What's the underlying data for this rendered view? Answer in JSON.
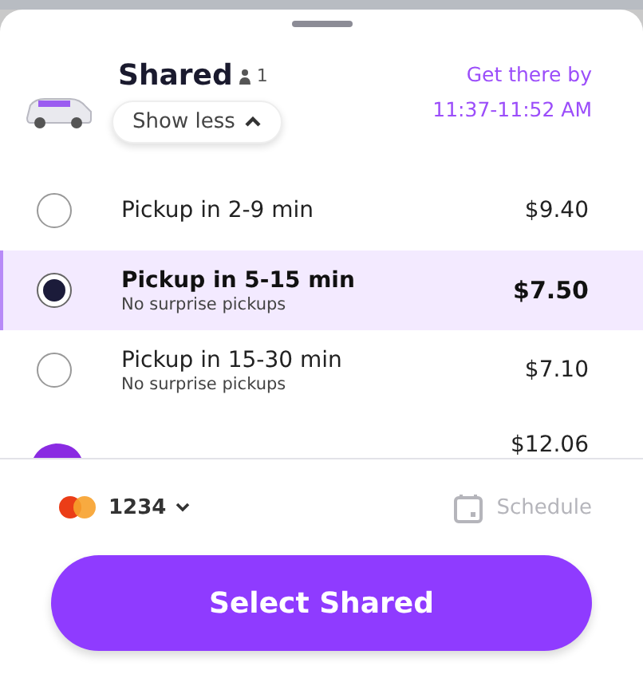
{
  "ride": {
    "name": "Shared",
    "seats": "1",
    "toggle": "Show less",
    "eta_label": "Get there by",
    "eta_time": "11:37-11:52 AM"
  },
  "options": [
    {
      "title": "Pickup in 2-9 min",
      "price": "$9.40",
      "selected": false
    },
    {
      "title": "Pickup in 5-15 min",
      "subtitle": "No surprise pickups",
      "price": "$7.50",
      "selected": true
    },
    {
      "title": "Pickup in 15-30 min",
      "subtitle": "No surprise pickups",
      "price": "$7.10",
      "selected": false
    }
  ],
  "next_ride": {
    "price": "$12.06"
  },
  "payment": {
    "card": "1234"
  },
  "schedule": {
    "label": "Schedule",
    "disabled": true
  },
  "action": {
    "label": "Select Shared"
  }
}
